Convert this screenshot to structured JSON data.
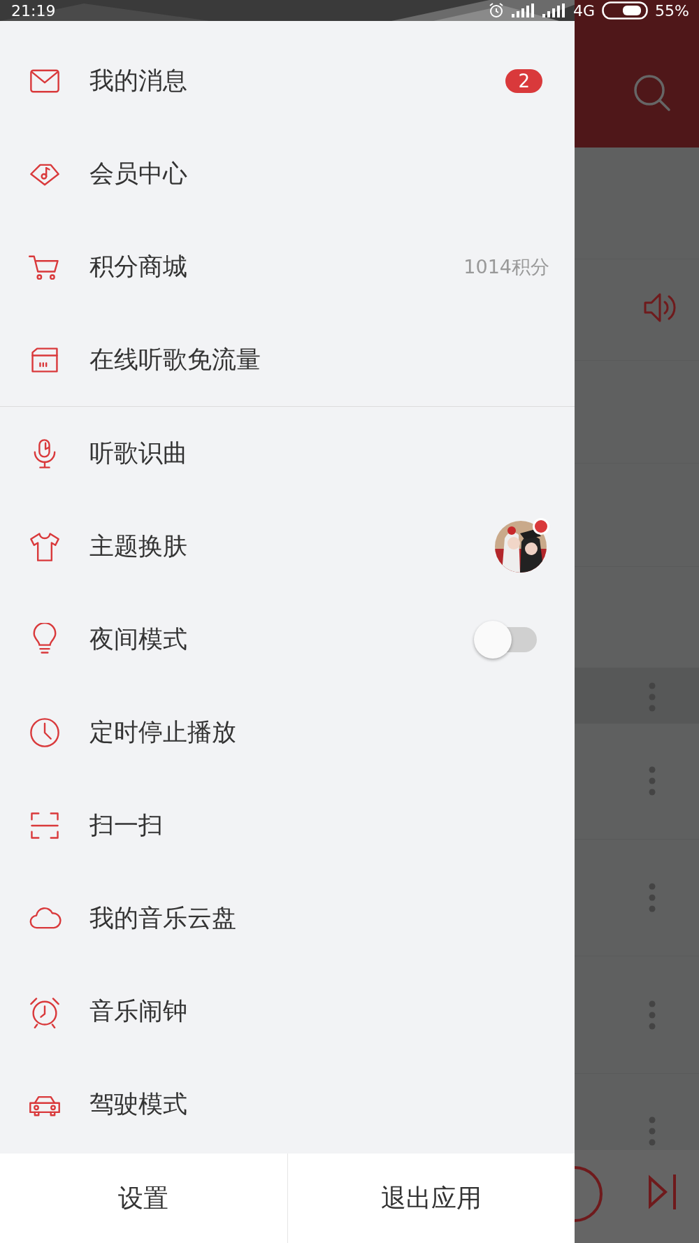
{
  "status_bar": {
    "time": "21:19",
    "network": "4G",
    "battery": "55%"
  },
  "drawer": {
    "sections": [
      {
        "items": [
          {
            "label": "我的消息",
            "kind": "badge",
            "badge": "2"
          },
          {
            "label": "会员中心",
            "kind": "plain"
          },
          {
            "label": "积分商城",
            "kind": "points",
            "points": "1014积分"
          },
          {
            "label": "在线听歌免流量",
            "kind": "plain"
          }
        ]
      },
      {
        "items": [
          {
            "label": "听歌识曲",
            "kind": "plain"
          },
          {
            "label": "主题换肤",
            "kind": "theme",
            "new": true
          },
          {
            "label": "夜间模式",
            "kind": "toggle",
            "on": false
          },
          {
            "label": "定时停止播放",
            "kind": "plain"
          },
          {
            "label": "扫一扫",
            "kind": "plain"
          },
          {
            "label": "我的音乐云盘",
            "kind": "plain"
          },
          {
            "label": "音乐闹钟",
            "kind": "plain"
          },
          {
            "label": "驾驶模式",
            "kind": "plain"
          }
        ]
      }
    ],
    "footer_buttons": [
      "设置",
      "退出应用"
    ]
  }
}
